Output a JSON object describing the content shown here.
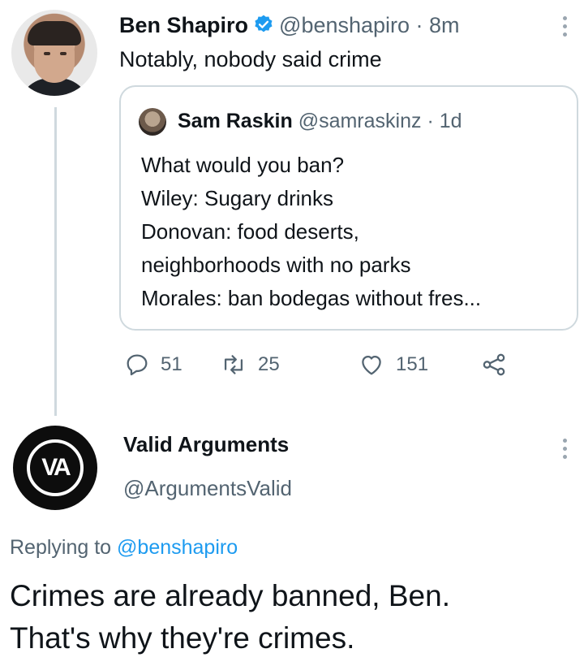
{
  "tweet": {
    "author_name": "Ben Shapiro",
    "handle_time": "@benshapiro · 8m",
    "text": "Notably, nobody said crime",
    "quoted": {
      "author_name": "Sam Raskin",
      "handle_time": "@samraskinz · 1d",
      "lines": [
        "What would you ban?",
        "Wiley: Sugary drinks",
        "Donovan: food deserts,",
        "neighborhoods with no parks",
        "Morales: ban bodegas without fres..."
      ]
    },
    "actions": {
      "reply_count": "51",
      "retweet_count": "25",
      "like_count": "151"
    }
  },
  "reply": {
    "author_name": "Valid Arguments",
    "handle": "@ArgumentsValid",
    "replying_prefix": "Replying to ",
    "replying_to": "@benshapiro",
    "text_lines": [
      "Crimes are already banned, Ben.",
      "That's why they're crimes."
    ],
    "avatar_text": "VA"
  },
  "colors": {
    "link": "#1d9bf0",
    "muted": "#536471",
    "verified": "#1d9bf0"
  },
  "icons": [
    "verified-badge-icon",
    "more-icon",
    "reply-icon",
    "retweet-icon",
    "like-icon",
    "share-icon"
  ]
}
